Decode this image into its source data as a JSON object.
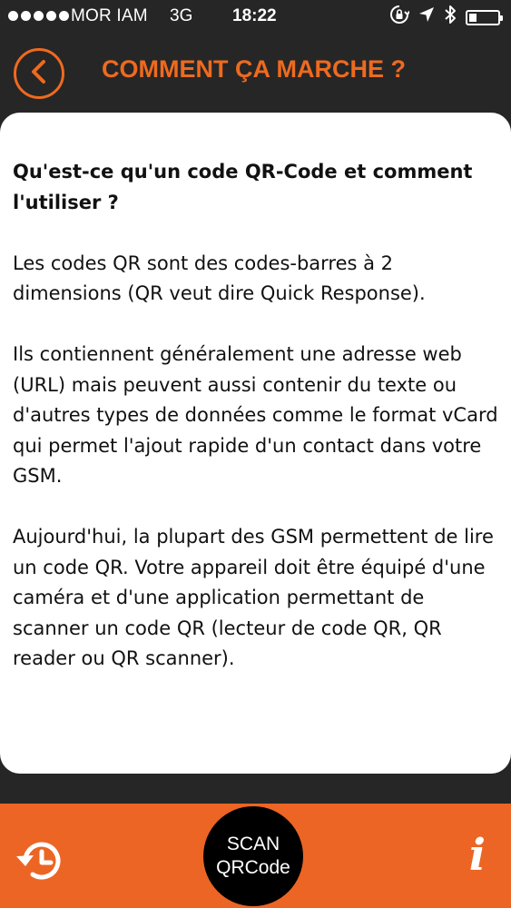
{
  "status_bar": {
    "carrier": "MOR IAM",
    "network": "3G",
    "time": "18:22",
    "battery_level": 0.25
  },
  "header": {
    "title": "COMMENT ÇA MARCHE ?",
    "back_icon": "chevron-left-icon"
  },
  "content": {
    "question": "Qu'est-ce qu'un code QR-Code et comment l'utiliser ?",
    "paragraphs": [
      "Les codes QR sont des codes-barres à 2 dimensions (QR veut dire Quick Response).",
      "Ils contiennent généralement une adresse web (URL) mais peuvent aussi contenir du texte ou d'autres types de données comme le format vCard qui permet l'ajout rapide d'un contact dans votre GSM.",
      "Aujourd'hui, la plupart des GSM permettent de lire un code QR. Votre appareil doit être équipé d'une caméra et d'une application permettant de scanner un code QR (lecteur de code QR, QR reader ou QR scanner)."
    ]
  },
  "bottom_bar": {
    "scan_line1": "SCAN",
    "scan_line2": "QRCode",
    "info_label": "i",
    "history_icon": "history-icon"
  },
  "colors": {
    "accent": "#ee6a1f",
    "bottom_bar": "#ec6524",
    "background": "#262626",
    "card": "#ffffff"
  }
}
